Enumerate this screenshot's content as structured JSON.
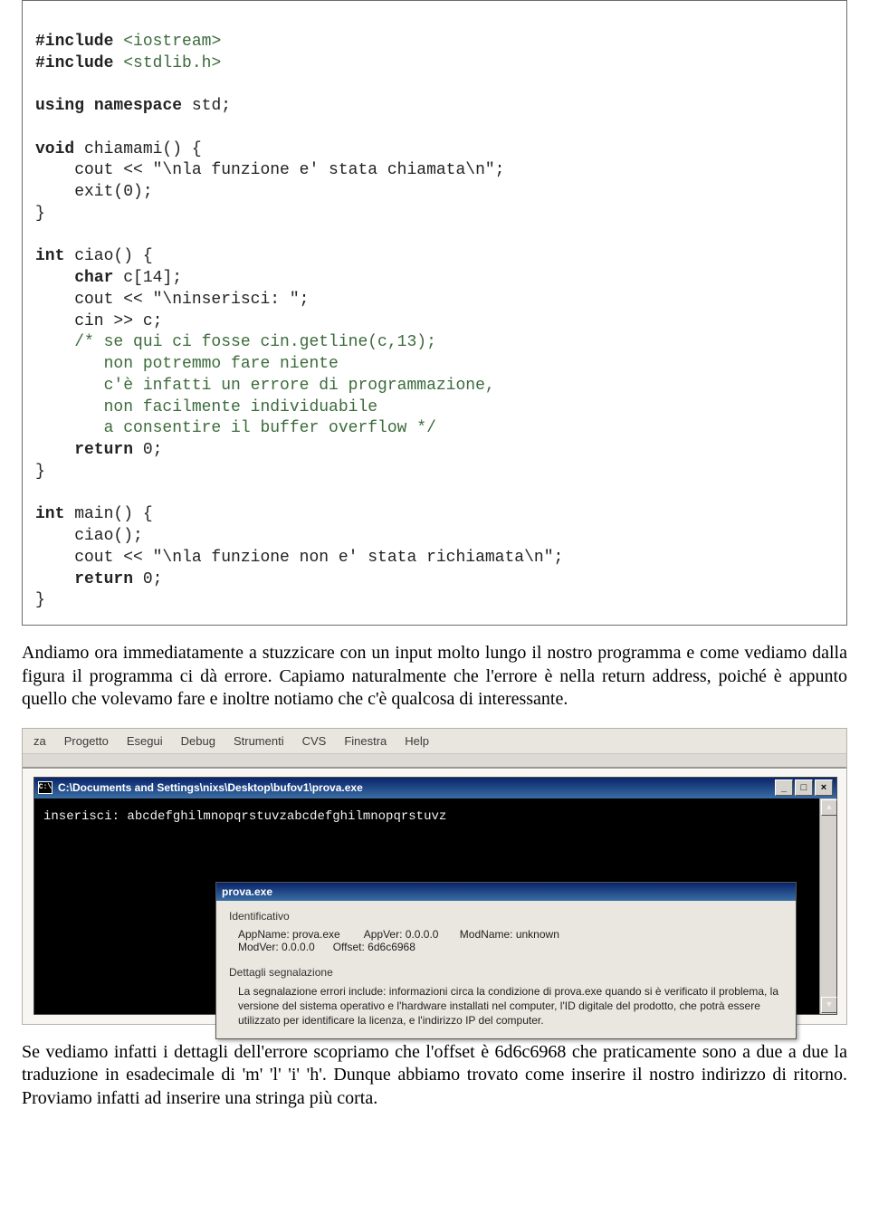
{
  "code": {
    "l01a": "#include",
    "l01b": " <iostream>",
    "l02a": "#include",
    "l02b": " <stdlib.h>",
    "l03": "",
    "l04a": "using",
    "l04b": " ",
    "l04c": "namespace",
    "l04d": " std;",
    "l05": "",
    "l06a": "void",
    "l06b": " chiamami() {",
    "l07": "    cout << \"\\nla funzione e' stata chiamata\\n\";",
    "l08": "    exit(0);",
    "l09": "}",
    "l10": "",
    "l11a": "int",
    "l11b": " ciao() {",
    "l12a": "    ",
    "l12b": "char",
    "l12c": " c[14];",
    "l13": "    cout << \"\\ninserisci: \";",
    "l14": "    cin >> c;",
    "l15": "    /* se qui ci fosse cin.getline(c,13);",
    "l16": "       non potremmo fare niente",
    "l17": "       c'è infatti un errore di programmazione,",
    "l18": "       non facilmente individuabile",
    "l19": "       a consentire il buffer overflow */",
    "l20a": "    ",
    "l20b": "return",
    "l20c": " 0;",
    "l21": "}",
    "l22": "",
    "l23a": "int",
    "l23b": " main() {",
    "l24": "    ciao();",
    "l25": "    cout << \"\\nla funzione non e' stata richiamata\\n\";",
    "l26a": "    ",
    "l26b": "return",
    "l26c": " 0;",
    "l27": "}"
  },
  "paragraph1": "Andiamo ora immediatamente a stuzzicare con un input molto lungo il nostro programma e come vediamo dalla figura il programma ci dà errore. Capiamo naturalmente che l'errore è nella return address, poiché è appunto quello che volevamo fare e inoltre notiamo che c'è qualcosa di interessante.",
  "menu": {
    "m0": "za",
    "m1": "Progetto",
    "m2": "Esegui",
    "m3": "Debug",
    "m4": "Strumenti",
    "m5": "CVS",
    "m6": "Finestra",
    "m7": "Help"
  },
  "console": {
    "icon": "C:\\",
    "title": "C:\\Documents and Settings\\nixs\\Desktop\\bufov1\\prova.exe",
    "line": "inserisci: abcdefghilmnopqrstuvzabcdefghilmnopqrstuvz",
    "btn_min": "_",
    "btn_max": "□",
    "btn_close": "×",
    "arrow_up": "▲",
    "arrow_down": "▼"
  },
  "dialog": {
    "title": "prova.exe",
    "section1": "Identificativo",
    "row1": "AppName: prova.exe        AppVer: 0.0.0.0       ModName: unknown",
    "row2": "ModVer: 0.0.0.0      Offset: 6d6c6968",
    "section2": "Dettagli segnalazione",
    "para": "La segnalazione errori include: informazioni circa la condizione di prova.exe quando si è verificato il problema, la versione del sistema operativo e l'hardware installati nel computer, l'ID digitale del prodotto, che potrà essere utilizzato per identificare la licenza, e l'indirizzo IP del computer."
  },
  "paragraph2": "Se vediamo infatti i dettagli dell'errore scopriamo che l'offset è 6d6c6968 che praticamente sono a due a due la traduzione in esadecimale di 'm' 'l' 'i' 'h'. Dunque abbiamo trovato come inserire il nostro indirizzo di ritorno. Proviamo infatti ad inserire una stringa più corta."
}
